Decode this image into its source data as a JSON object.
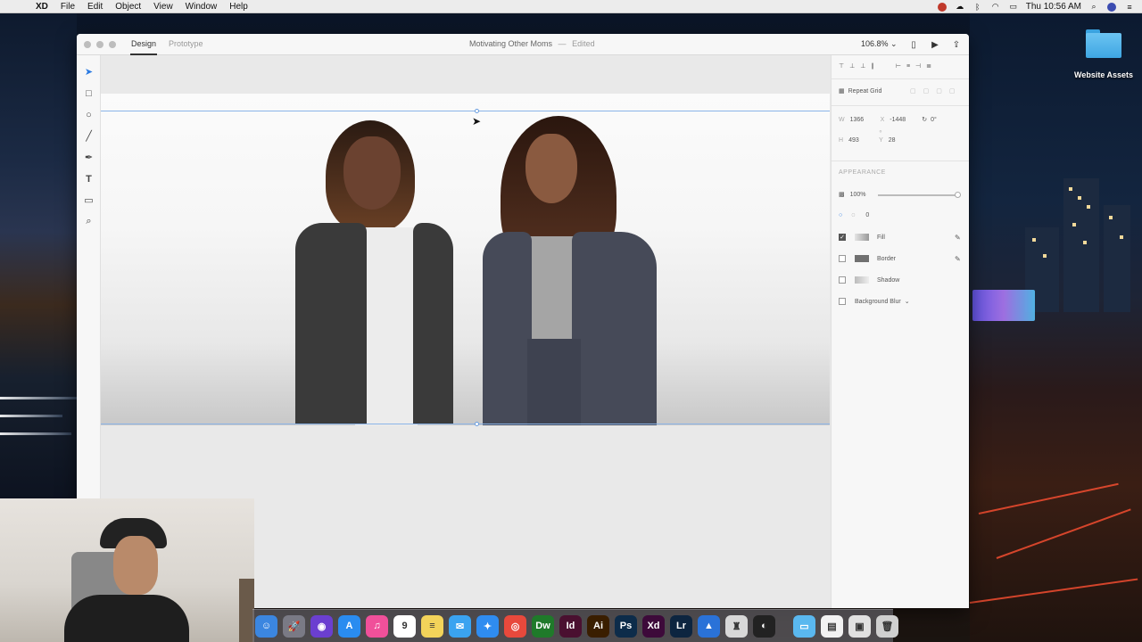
{
  "menubar": {
    "app_name": "XD",
    "items": [
      "File",
      "Edit",
      "Object",
      "View",
      "Window",
      "Help"
    ],
    "clock": "Thu 10:56 AM"
  },
  "desktop": {
    "folder_label": "Website Assets"
  },
  "window": {
    "tabs": [
      "Design",
      "Prototype"
    ],
    "active_tab": "Design",
    "document_title": "Motivating Other Moms",
    "document_status": "Edited",
    "zoom": "106.8%"
  },
  "tools": [
    "select-tool",
    "rectangle-tool",
    "ellipse-tool",
    "line-tool",
    "pen-tool",
    "text-tool",
    "artboard-tool",
    "zoom-tool"
  ],
  "inspector": {
    "repeat_grid_label": "Repeat Grid",
    "w_label": "W",
    "w_value": "1366",
    "x_label": "X",
    "x_value": "-1448",
    "rotation": "0°",
    "h_label": "H",
    "h_value": "493",
    "y_label": "Y",
    "y_value": "28",
    "appearance_heading": "APPEARANCE",
    "opacity": "100%",
    "opacity_fraction": 1.0,
    "corner_radius": "0",
    "fill_label": "Fill",
    "fill_checked": true,
    "border_label": "Border",
    "border_checked": false,
    "shadow_label": "Shadow",
    "shadow_checked": false,
    "background_blur_label": "Background Blur"
  },
  "dock": {
    "apps": [
      {
        "name": "finder",
        "glyph": "☺",
        "color": "#3b86e0"
      },
      {
        "name": "launchpad",
        "glyph": "🚀",
        "color": "#7a7a85"
      },
      {
        "name": "siri",
        "glyph": "◉",
        "color": "#6b3fd0"
      },
      {
        "name": "app-store",
        "glyph": "A",
        "color": "#2a8cf0"
      },
      {
        "name": "itunes",
        "glyph": "♫",
        "color": "#f0509a"
      },
      {
        "name": "calendar",
        "glyph": "9",
        "color": "#ffffff"
      },
      {
        "name": "notes",
        "glyph": "≡",
        "color": "#f3d35a"
      },
      {
        "name": "messages",
        "glyph": "✉",
        "color": "#3aa3f0"
      },
      {
        "name": "safari",
        "glyph": "✦",
        "color": "#2f8cf0"
      },
      {
        "name": "chrome",
        "glyph": "◎",
        "color": "#e8493c"
      },
      {
        "name": "dreamweaver",
        "glyph": "Dw",
        "color": "#1f7a2a"
      },
      {
        "name": "indesign",
        "glyph": "Id",
        "color": "#4a1030"
      },
      {
        "name": "illustrator",
        "glyph": "Ai",
        "color": "#3a1e00"
      },
      {
        "name": "photoshop",
        "glyph": "Ps",
        "color": "#0d2c4a"
      },
      {
        "name": "xd",
        "glyph": "Xd",
        "color": "#3d0a3a"
      },
      {
        "name": "lightroom",
        "glyph": "Lr",
        "color": "#0d2540"
      },
      {
        "name": "app-store-alt",
        "glyph": "▲",
        "color": "#2a72d8"
      },
      {
        "name": "sequel",
        "glyph": "♜",
        "color": "#d8d8d8"
      },
      {
        "name": "obs",
        "glyph": "◐",
        "color": "#222222"
      }
    ],
    "trailing": [
      {
        "name": "folder",
        "glyph": "▭",
        "color": "#5ab8ef"
      },
      {
        "name": "document",
        "glyph": "▤",
        "color": "#f2f2f2"
      },
      {
        "name": "preview",
        "glyph": "▣",
        "color": "#e0e0e0"
      },
      {
        "name": "trash",
        "glyph": "🗑",
        "color": "#cfcfcf"
      }
    ]
  }
}
